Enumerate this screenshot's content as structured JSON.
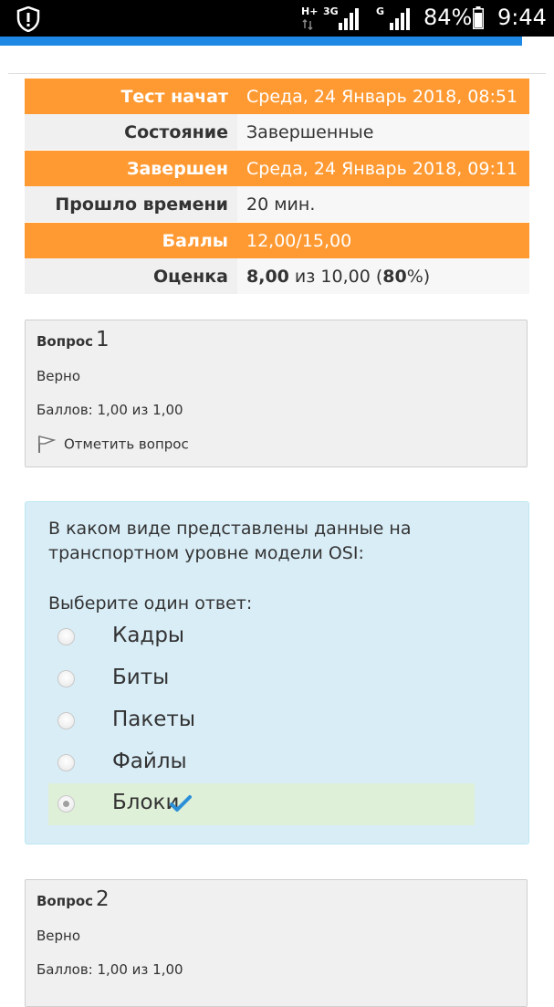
{
  "status_bar": {
    "network_1": "H+",
    "network_2": "3G",
    "network_3": "G",
    "battery_percent": "84%",
    "time": "9:44"
  },
  "summary": {
    "rows": [
      {
        "key": "Тест начат",
        "value": "Среда, 24 Январь 2018, 08:51"
      },
      {
        "key": "Состояние",
        "value": "Завершенные"
      },
      {
        "key": "Завершен",
        "value": "Среда, 24 Январь 2018, 09:11"
      },
      {
        "key": "Прошло времени",
        "value": "20 мин."
      },
      {
        "key": "Баллы",
        "value": "12,00/15,00"
      },
      {
        "key": "Оценка",
        "value_bold_1": "8,00",
        "value_mid": " из 10,00 (",
        "value_bold_2": "80",
        "value_end": "%)"
      }
    ]
  },
  "question1": {
    "label": "Вопрос",
    "number": "1",
    "state": "Верно",
    "grade": "Баллов: 1,00 из 1,00",
    "flag_label": "Отметить вопрос"
  },
  "question1_content": {
    "text": "В каком виде представлены данные на транспортном уровне модели OSI:",
    "prompt": "Выберите один ответ:",
    "options": [
      {
        "label": "Кадры"
      },
      {
        "label": "Биты"
      },
      {
        "label": "Пакеты"
      },
      {
        "label": "Файлы"
      },
      {
        "label": "Блоки"
      }
    ],
    "selected_index": 4
  },
  "question2": {
    "label": "Вопрос",
    "number": "2",
    "state": "Верно",
    "grade": "Баллов: 1,00 из 1,00"
  },
  "colors": {
    "orange": "#ff9a33",
    "blue_bar": "#1e88e5",
    "info_bg": "#d9edf7",
    "correct_bg": "#dff0d8",
    "check": "#2b8fd8"
  }
}
